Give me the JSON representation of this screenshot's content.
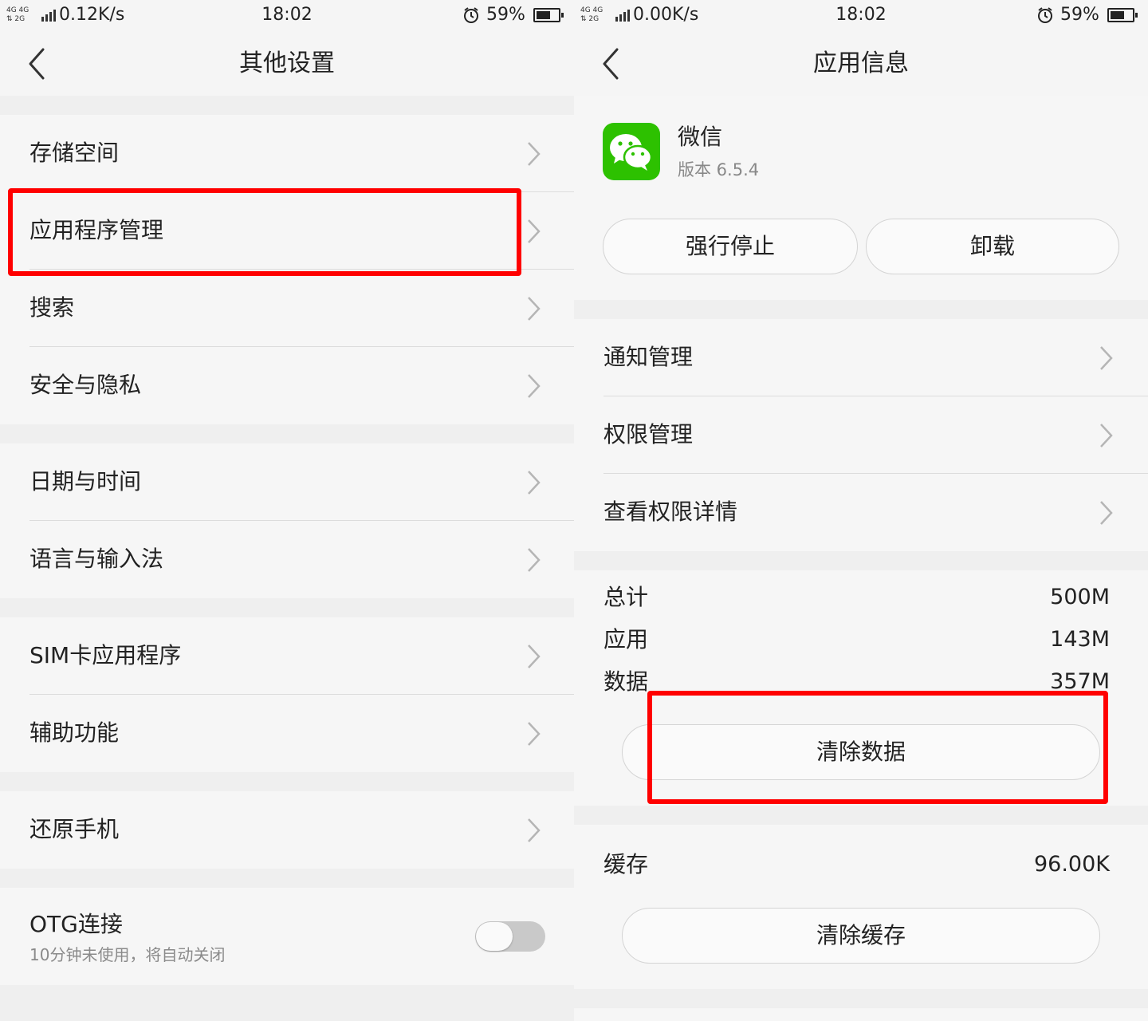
{
  "left": {
    "status": {
      "signal": "4G 4G 2G",
      "net_speed": "0.12K/s",
      "time": "18:02",
      "battery": "59%"
    },
    "title": "其他设置",
    "groups": [
      [
        "存储空间",
        "应用程序管理",
        "搜索",
        "安全与隐私"
      ],
      [
        "日期与时间",
        "语言与输入法"
      ],
      [
        "SIM卡应用程序",
        "辅助功能"
      ],
      [
        "还原手机"
      ]
    ],
    "otg": {
      "label": "OTG连接",
      "sub": "10分钟未使用，将自动关闭",
      "enabled": false
    }
  },
  "right": {
    "status": {
      "signal": "4G 4G 2G",
      "net_speed": "0.00K/s",
      "time": "18:02",
      "battery": "59%"
    },
    "title": "应用信息",
    "app": {
      "name": "微信",
      "version": "版本 6.5.4"
    },
    "buttons": {
      "force_stop": "强行停止",
      "uninstall": "卸载",
      "clear_data": "清除数据",
      "clear_cache": "清除缓存"
    },
    "menu": [
      "通知管理",
      "权限管理",
      "查看权限详情"
    ],
    "storage": [
      {
        "label": "总计",
        "value": "500M"
      },
      {
        "label": "应用",
        "value": "143M"
      },
      {
        "label": "数据",
        "value": "357M"
      }
    ],
    "cache": {
      "label": "缓存",
      "value": "96.00K"
    }
  },
  "colors": {
    "highlight": "#ff0000",
    "wechat_green": "#2dc100",
    "background": "#efefef",
    "surface": "#f6f6f6"
  },
  "icons": [
    "back-icon",
    "chevron-right-icon",
    "alarm-icon",
    "battery-icon",
    "signal-icon",
    "wechat-icon"
  ]
}
